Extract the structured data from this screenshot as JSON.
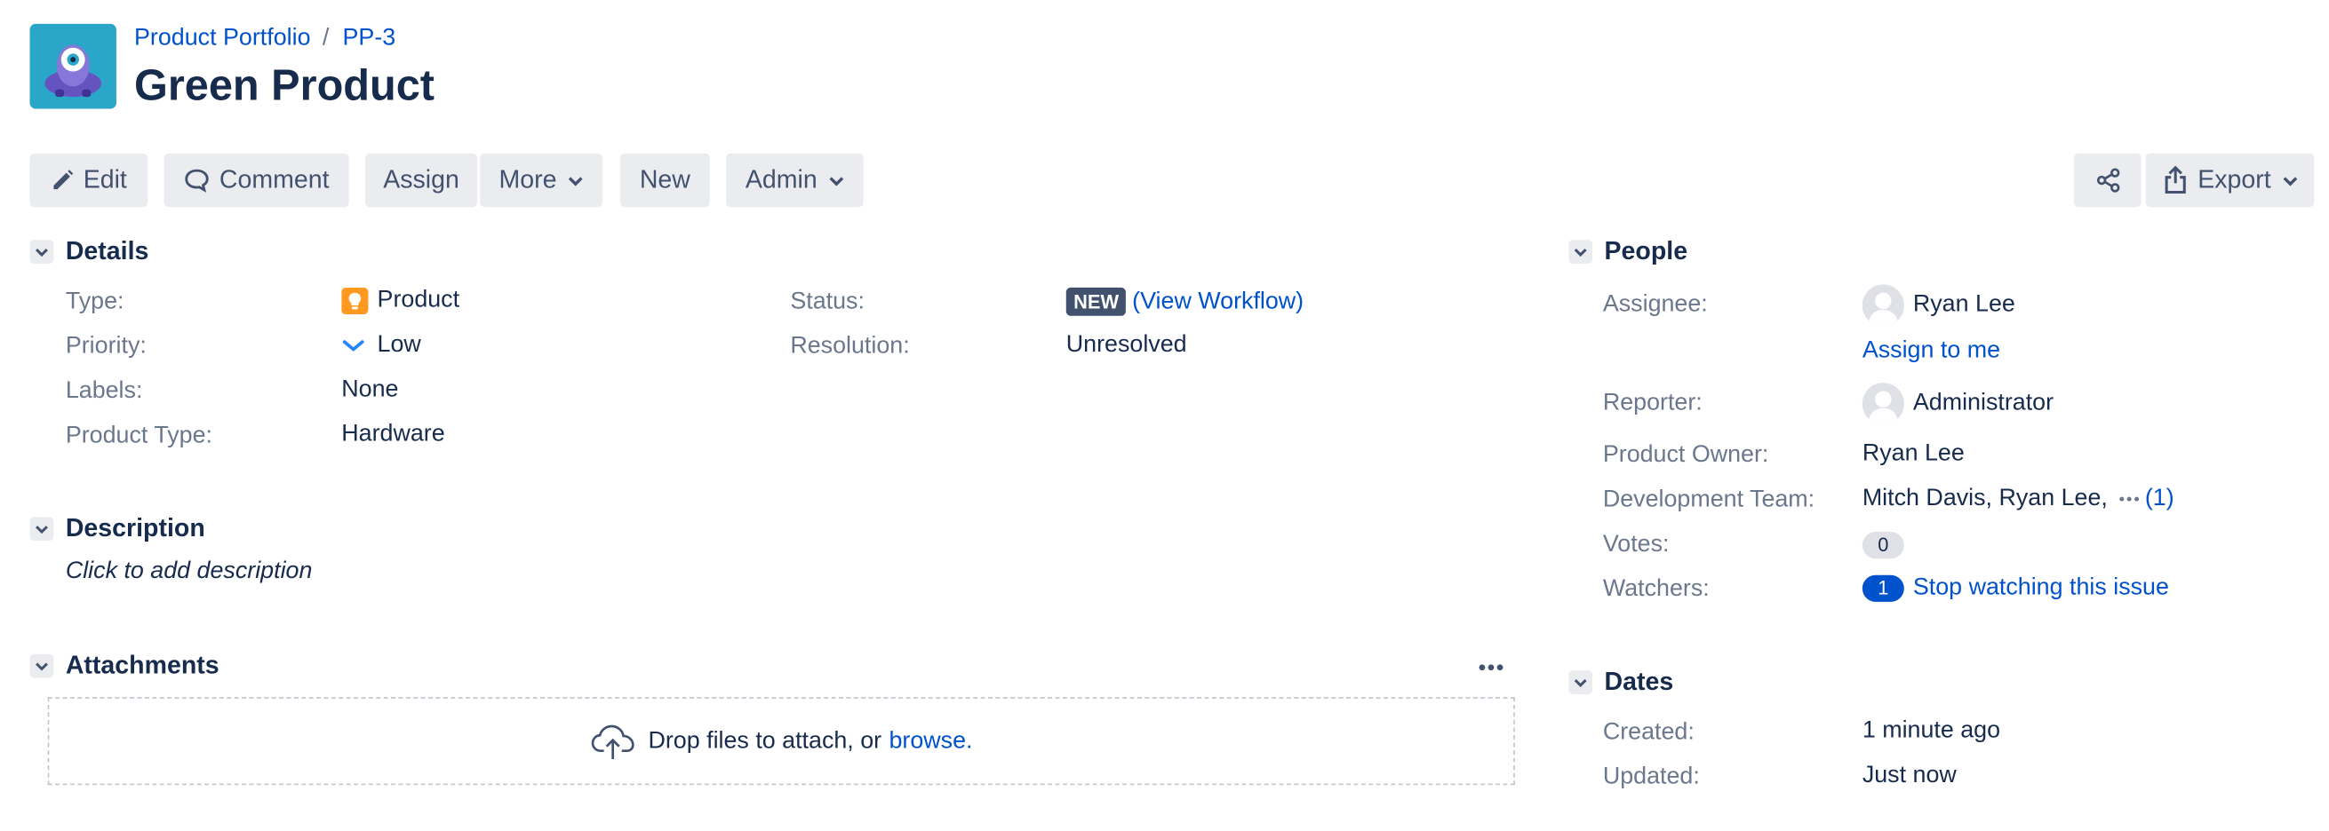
{
  "header": {
    "breadcrumb": {
      "project": "Product Portfolio",
      "separator": "/",
      "issue_key": "PP-3"
    },
    "title": "Green Product"
  },
  "toolbar": {
    "edit": "Edit",
    "comment": "Comment",
    "assign": "Assign",
    "more": "More",
    "new": "New",
    "admin": "Admin",
    "export": "Export"
  },
  "details": {
    "heading": "Details",
    "type": {
      "label": "Type:",
      "value": "Product"
    },
    "priority": {
      "label": "Priority:",
      "value": "Low"
    },
    "labels": {
      "label": "Labels:",
      "value": "None"
    },
    "product_type": {
      "label": "Product Type:",
      "value": "Hardware"
    },
    "status": {
      "label": "Status:",
      "lozenge": "NEW",
      "open_paren": "(",
      "link": "View Workflow",
      "close_paren": ")"
    },
    "resolution": {
      "label": "Resolution:",
      "value": "Unresolved"
    }
  },
  "description": {
    "heading": "Description",
    "placeholder": "Click to add description"
  },
  "attachments": {
    "heading": "Attachments",
    "drop_text": "Drop files to attach, or",
    "browse_link": "browse."
  },
  "people": {
    "heading": "People",
    "assignee": {
      "label": "Assignee:",
      "value": "Ryan Lee",
      "assign_to_me": "Assign to me"
    },
    "reporter": {
      "label": "Reporter:",
      "value": "Administrator"
    },
    "product_owner": {
      "label": "Product Owner:",
      "value": "Ryan Lee"
    },
    "development_team": {
      "label": "Development Team:",
      "value": "Mitch Davis, Ryan Lee,",
      "more_count": "(1)"
    },
    "votes": {
      "label": "Votes:",
      "count": "0"
    },
    "watchers": {
      "label": "Watchers:",
      "count": "1",
      "link": "Stop watching this issue"
    }
  },
  "dates": {
    "heading": "Dates",
    "created": {
      "label": "Created:",
      "value": "1 minute ago"
    },
    "updated": {
      "label": "Updated:",
      "value": "Just now"
    }
  },
  "colors": {
    "link": "#0052cc",
    "text": "#172b4d",
    "muted": "#6b778c",
    "button_bg": "#ebecf0",
    "lozenge_bg": "#42526e",
    "product_icon": "#ff991f",
    "priority_low": "#2684ff"
  },
  "icons": [
    "project-avatar",
    "pencil-icon",
    "comment-icon",
    "chevron-down-icon",
    "share-icon",
    "export-icon",
    "lightbulb-icon",
    "priority-low-icon",
    "user-avatar-icon",
    "ellipsis-icon",
    "upload-cloud-icon"
  ]
}
